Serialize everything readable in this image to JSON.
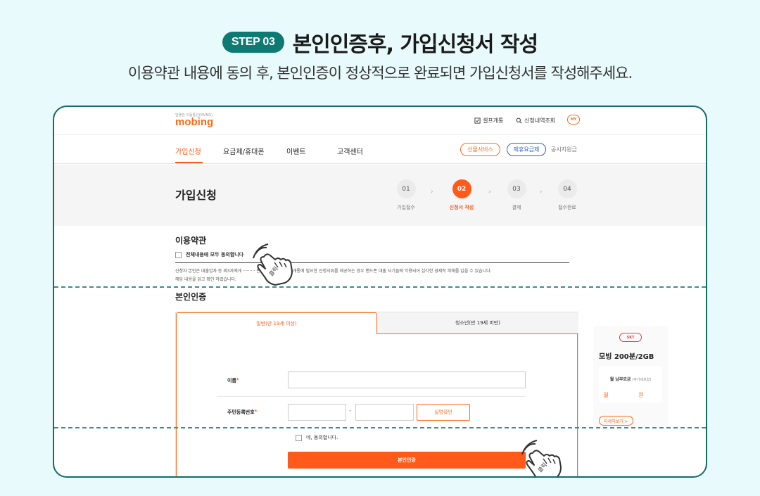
{
  "headline": {
    "step": "STEP 03",
    "title": "본인인증후, 가입신청서 작성",
    "subtitle": "이용약관 내용에 동의 후, 본인인증이 정상적으로 완료되면 가입신청서를 작성해주세요."
  },
  "site": {
    "logo_sub": "알뜰한 이동통신(MVNO)",
    "logo": "mobing",
    "util": [
      {
        "label": "셀프개통",
        "icon": "check-square-icon"
      },
      {
        "label": "신청내역조회",
        "icon": "search-icon"
      }
    ],
    "my_label": "MY"
  },
  "nav": {
    "items": [
      "가입신청",
      "요금제/휴대폰",
      "이벤트",
      "고객센터"
    ],
    "pill_orange": "선물서비스",
    "pill_blue": "제휴요금제",
    "plain": "공시지원금"
  },
  "signup": {
    "title": "가입신청",
    "steps": [
      {
        "num": "01",
        "label": "가입접수"
      },
      {
        "num": "02",
        "label": "신청서 작성"
      },
      {
        "num": "03",
        "label": "결제"
      },
      {
        "num": "04",
        "label": "접수완료"
      }
    ],
    "active_step": 2
  },
  "terms": {
    "title": "이용약관",
    "agree_all": "전체내용에 모두 동의합니다",
    "body_line1": "신청자 본인은 대출업자 등 제3자에게 ········· 폰을 개통해 주거나, 개통에 필요한 신청서류를 제공하는 경우 핸드폰 대출 사기들에 악용되어 심각한 경제적 피해를 입을 수 있습니다.",
    "body_line2": "해당 내용을 읽고 확인 하였습니다."
  },
  "auth": {
    "title": "본인인증",
    "tab_adult": "일반(만 19세 이상)",
    "tab_youth": "청소년(만 19세 미만)",
    "name_label": "이름",
    "rrn_label": "주민등록번호",
    "rrn_sep": "-",
    "verify_btn": "실명확인",
    "agree": "네, 동의합니다.",
    "submit": "본인인증"
  },
  "plan": {
    "carrier": "SKT",
    "name": "모빙 200분/2GB",
    "fee_label": "월 납부요금",
    "fee_note": "(부가세포함)",
    "fee_value": "월 원",
    "detail": "자세히보기 >"
  },
  "hand_label": "클릭",
  "colors": {
    "accent": "#ff5a1a",
    "teal": "#0f7a73",
    "blue": "#2563c9",
    "skt_red": "#e63946",
    "background": "#e8fafb"
  }
}
